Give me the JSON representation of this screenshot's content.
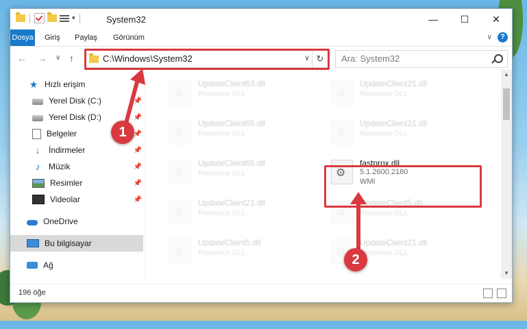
{
  "window": {
    "title": "System32"
  },
  "window_buttons": {
    "minimize": "—",
    "maximize": "☐",
    "close": "✕"
  },
  "ribbon": {
    "tabs": [
      "Dosya",
      "Giriş",
      "Paylaş",
      "Görünüm"
    ],
    "help": "?",
    "expand": "∨"
  },
  "navigation": {
    "back": "←",
    "forward": "→",
    "recent": "∨",
    "up": "↑",
    "address": "C:\\Windows\\System32",
    "address_dropdown": "∨",
    "refresh": "↻",
    "search_placeholder": "Ara: System32"
  },
  "sidebar": {
    "items": [
      {
        "label": "Hızlı erişim",
        "icon": "star-icon"
      },
      {
        "label": "Yerel Disk (C:)",
        "icon": "drive-icon",
        "pinned": true
      },
      {
        "label": "Yerel Disk (D:)",
        "icon": "drive-icon",
        "pinned": true
      },
      {
        "label": "Belgeler",
        "icon": "documents-icon",
        "pinned": true
      },
      {
        "label": "İndirmeler",
        "icon": "downloads-icon",
        "pinned": true
      },
      {
        "label": "Müzik",
        "icon": "music-icon",
        "pinned": true
      },
      {
        "label": "Resimler",
        "icon": "pictures-icon",
        "pinned": true
      },
      {
        "label": "Videolar",
        "icon": "videos-icon",
        "pinned": true
      },
      {
        "label": "OneDrive",
        "icon": "onedrive-icon"
      },
      {
        "label": "Bu bilgisayar",
        "icon": "computer-icon",
        "selected": true
      },
      {
        "label": "Ağ",
        "icon": "network-icon"
      }
    ]
  },
  "files": [
    {
      "name": "UpdateClient63.dll",
      "desc": "Resource DLL"
    },
    {
      "name": "UpdateClient21.dll",
      "desc": "Resource DLL"
    },
    {
      "name": "UpdateClient65.dll",
      "desc": "Resource DLL"
    },
    {
      "name": "UpdateClient21.dll",
      "desc": "Resource DLL"
    },
    {
      "name": "UpdateClient65.dll",
      "desc": "Resource DLL"
    },
    {
      "name": "fastprox.dll",
      "version": "5.1.2600.2180",
      "company": "WMI"
    },
    {
      "name": "UpdateClient21.dll",
      "desc": "Resource DLL"
    },
    {
      "name": "UpdateClient5.dll",
      "desc": "Resource DLL"
    },
    {
      "name": "UpdateClient5.dll",
      "desc": "Resource DLL"
    },
    {
      "name": "UpdateClient21.dll",
      "desc": "Resource DLL"
    }
  ],
  "status": {
    "item_count": "196 öğe"
  },
  "callouts": {
    "one": "1",
    "two": "2"
  },
  "colors": {
    "accent": "#1979ca",
    "highlight": "#d9393f"
  }
}
